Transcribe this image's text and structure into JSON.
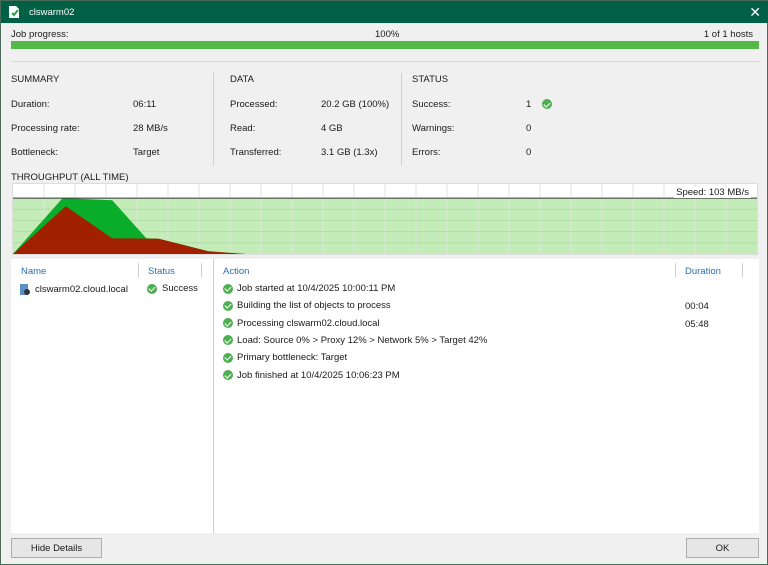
{
  "window": {
    "title": "clswarm02",
    "icon": "veeam-job-icon",
    "close_icon": "close-icon"
  },
  "progress": {
    "label": "Job progress:",
    "percent_text": "100%",
    "percent": 100,
    "hosts": "1 of 1 hosts"
  },
  "summary": {
    "heading": "SUMMARY",
    "items": [
      {
        "label": "Duration:",
        "value": "06:11"
      },
      {
        "label": "Processing rate:",
        "value": "28 MB/s"
      },
      {
        "label": "Bottleneck:",
        "value": "Target"
      }
    ]
  },
  "data": {
    "heading": "DATA",
    "items": [
      {
        "label": "Processed:",
        "value": "20.2 GB (100%)"
      },
      {
        "label": "Read:",
        "value": "4 GB"
      },
      {
        "label": "Transferred:",
        "value": "3.1 GB (1.3x)"
      }
    ]
  },
  "status": {
    "heading": "STATUS",
    "items": [
      {
        "label": "Success:",
        "value": "1"
      },
      {
        "label": "Warnings:",
        "value": "0"
      },
      {
        "label": "Errors:",
        "value": "0"
      }
    ]
  },
  "chart_data": {
    "type": "area",
    "title": "THROUGHPUT (ALL TIME)",
    "speed_label": "Speed: 103 MB/s",
    "speed": 103,
    "ylim": [
      0,
      129
    ],
    "xlim": [
      0,
      24
    ],
    "colors": {
      "read": "#0aad2a",
      "transferred": "#a02000",
      "background": "#c3ecb8"
    },
    "series": [
      {
        "name": "read",
        "x": [
          0,
          1.6,
          3.2,
          4.3,
          4.7,
          6.3,
          7.5
        ],
        "y": [
          0,
          103,
          99,
          29,
          28,
          5,
          0
        ]
      },
      {
        "name": "transferred",
        "x": [
          0,
          1.7,
          3.2,
          4.7,
          6.3,
          7.5
        ],
        "y": [
          0,
          88,
          29,
          28,
          5,
          0
        ]
      }
    ]
  },
  "objects": {
    "headers": {
      "name": "Name",
      "status": "Status"
    },
    "rows": [
      {
        "name": "clswarm02.cloud.local",
        "status": "Success"
      }
    ]
  },
  "log": {
    "headers": {
      "action": "Action",
      "duration": "Duration"
    },
    "rows": [
      {
        "action": "Job started at 10/4/2025 10:00:11 PM",
        "duration": ""
      },
      {
        "action": "Building the list of objects to process",
        "duration": "00:04"
      },
      {
        "action": "Processing clswarm02.cloud.local",
        "duration": "05:48"
      },
      {
        "action": "Load: Source 0% > Proxy 12% > Network 5% > Target 42%",
        "duration": ""
      },
      {
        "action": "Primary bottleneck: Target",
        "duration": ""
      },
      {
        "action": "Job finished at 10/4/2025 10:06:23 PM",
        "duration": ""
      }
    ]
  },
  "buttons": {
    "hide_details": "Hide Details",
    "ok": "OK"
  }
}
